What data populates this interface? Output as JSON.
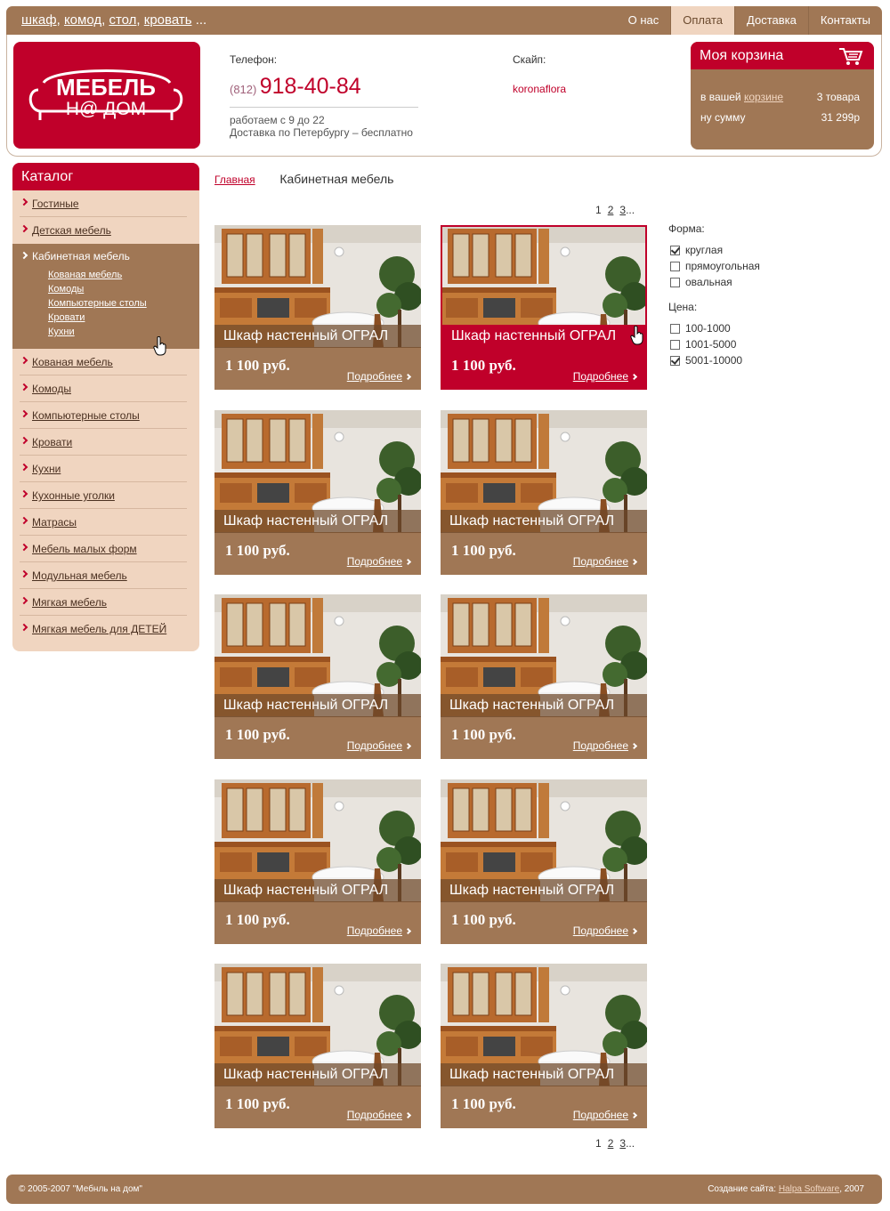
{
  "topbar": {
    "quick_links": [
      "шкаф",
      "комод",
      "стол",
      "кровать"
    ],
    "quick_ellipsis": "...",
    "nav": [
      {
        "label": "О нас",
        "active": false
      },
      {
        "label": "Оплата",
        "active": true
      },
      {
        "label": "Доставка",
        "active": false
      },
      {
        "label": "Контакты",
        "active": false
      }
    ]
  },
  "header": {
    "logo_line1": "МЕБЕЛЬ",
    "logo_line2": "Н@ ДОМ",
    "phone_label": "Телефон:",
    "phone_code": "(812)",
    "phone_number": "918-40-84",
    "hours": "работаем с 9 до 22",
    "delivery": "Доставка по Петербургу – бесплатно",
    "skype_label": "Скайп:",
    "skype": "koronaflora"
  },
  "cart": {
    "title": "Моя корзина",
    "row1_prefix": "в вашей",
    "row1_link": "корзине",
    "row1_value": "3 товара",
    "row2_label": "ну сумму",
    "row2_value": "31 299р"
  },
  "sidebar": {
    "title": "Каталог",
    "items_before": [
      "Гостиные",
      "Детская мебель"
    ],
    "active": {
      "label": "Кабинетная мебель",
      "subitems": [
        "Кованая мебель",
        "Комоды",
        "Компьютерные столы",
        "Кровати",
        "Кухни"
      ]
    },
    "items_after": [
      "Кованая мебель",
      "Комоды",
      "Компьютерные столы",
      "Кровати",
      "Кухни",
      "Кухонные уголки",
      "Матрасы",
      "Мебель малых форм",
      "Модульная мебель",
      "Мягкая мебель",
      "Мягкая мебель для ДЕТЕЙ"
    ]
  },
  "breadcrumb": {
    "home": "Главная",
    "current": "Кабинетная мебель"
  },
  "pager": {
    "current": "1",
    "pages": [
      "2",
      "3"
    ],
    "ellipsis": "..."
  },
  "products": [
    {
      "name": "Шкаф настенный ОГРАЛ",
      "price": "1 100 руб.",
      "more": "Подробнее",
      "hover": false
    },
    {
      "name": "Шкаф настенный ОГРАЛ",
      "price": "1 100 руб.",
      "more": "Подробнее",
      "hover": true
    },
    {
      "name": "Шкаф настенный ОГРАЛ",
      "price": "1 100 руб.",
      "more": "Подробнее",
      "hover": false
    },
    {
      "name": "Шкаф настенный ОГРАЛ",
      "price": "1 100 руб.",
      "more": "Подробнее",
      "hover": false
    },
    {
      "name": "Шкаф настенный ОГРАЛ",
      "price": "1 100 руб.",
      "more": "Подробнее",
      "hover": false
    },
    {
      "name": "Шкаф настенный ОГРАЛ",
      "price": "1 100 руб.",
      "more": "Подробнее",
      "hover": false
    },
    {
      "name": "Шкаф настенный ОГРАЛ",
      "price": "1 100 руб.",
      "more": "Подробнее",
      "hover": false
    },
    {
      "name": "Шкаф настенный ОГРАЛ",
      "price": "1 100 руб.",
      "more": "Подробнее",
      "hover": false
    },
    {
      "name": "Шкаф настенный ОГРАЛ",
      "price": "1 100 руб.",
      "more": "Подробнее",
      "hover": false
    },
    {
      "name": "Шкаф настенный ОГРАЛ",
      "price": "1 100 руб.",
      "more": "Подробнее",
      "hover": false
    }
  ],
  "filters": {
    "shape_title": "Форма:",
    "shapes": [
      {
        "label": "круглая",
        "checked": true
      },
      {
        "label": "прямоугольная",
        "checked": false
      },
      {
        "label": "овальная",
        "checked": false
      }
    ],
    "price_title": "Цена:",
    "prices": [
      {
        "label": "100-1000",
        "checked": false
      },
      {
        "label": "1001-5000",
        "checked": false
      },
      {
        "label": "5001-10000",
        "checked": true
      }
    ]
  },
  "footer": {
    "copyright": "© 2005-2007 \"Мебнль на дом\"",
    "credit_prefix": "Создание сайта:",
    "credit_link": "Halpa Software",
    "credit_year": ", 2007"
  },
  "colors": {
    "brand_red": "#c0002a",
    "brown": "#a07755",
    "beige": "#f0d5c0"
  },
  "icons": [
    "cart-icon",
    "chevron-right-icon",
    "hand-cursor-icon",
    "checkbox-icon"
  ]
}
